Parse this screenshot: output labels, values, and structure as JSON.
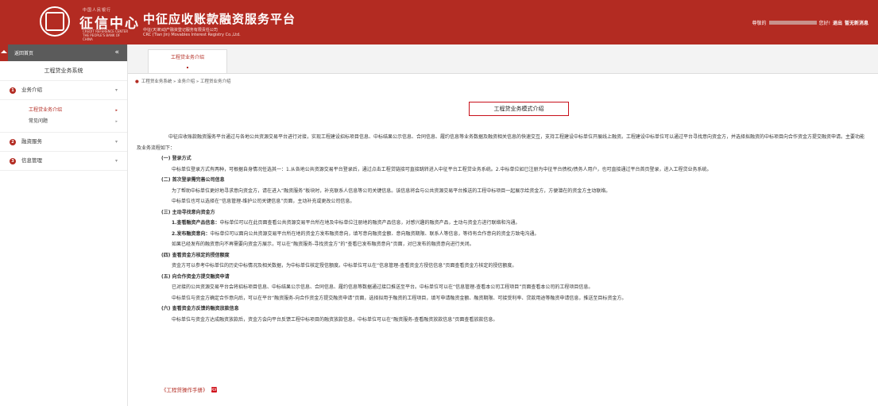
{
  "header": {
    "brand_tag": "中国人民银行",
    "brand_name": "征信中心",
    "brand_en": "Credit Reference Center The People's Bank of China",
    "platform_title": "中征应收账款融资服务平台",
    "platform_sub": "中征(天津)动产融资登记服务有限责任公司",
    "platform_sub_en": "CRC (Tian Jin) Movables Interest Registry Co.,Ltd.",
    "greeting_prefix": "尊敬的",
    "greeting_suffix": "您好!",
    "logout": "退出",
    "messages": "暂无新消息"
  },
  "sidebar": {
    "home": "返回首页",
    "collapse": "«",
    "system": "工程贷业务系统",
    "groups": [
      {
        "num": "1",
        "label": "业务介绍"
      },
      {
        "num": "2",
        "label": "融资服务"
      },
      {
        "num": "3",
        "label": "信息管理"
      }
    ],
    "sub_items": [
      {
        "label": "工程贷业务介绍"
      },
      {
        "label": "常见问题"
      }
    ]
  },
  "tab": {
    "label": "工程贷业务介绍"
  },
  "breadcrumb": "工程贷业务系统 » 业务介绍 » 工程贷业务介绍",
  "main": {
    "title": "工程贷业务模式介绍",
    "intro": "中征应收账款融资服务平台通过与各地公共资源交易平台进行对接，实现工程建设招标项目信息、中标结果公示信息、合同信息、履约信息等业务数据及融资相关信息的快速交互，支持工程建设中标单位开展线上融资。工程建设中标单位可以通过平台寻找意向资金方，并选择拟融资的中标项目向合作资金方提交融资申请。主要功能及业务流程如下：",
    "s1_title": "(一) 登录方式",
    "s1_p1": "中标单位登录方式有两种，可根据自身情况任选其一：1.从各地公共资源交易平台登录后，通过点击工程贷链接可直接跳转进入中征平台工程贷业务系统。2.中标单位如已注册为中征平台债权/债务人用户，也可直接通过平台首页登录，进入工程贷业务系统。",
    "s2_title": "(二) 首次登录需完善公司信息",
    "s2_p1": "为了帮助中标单位更好地寻求意向资金方，请在进入“融资服务”板块时，补充联系人信息等公司关键信息。该信息将会与公共资源交易平台推送的工程中标项目一起展示给资金方，方便潜在的资金方主动联络。",
    "s2_p2": "中标单位也可以选择在“信息管理-维护公司关键信息”页面，主动补充或更改公司信息。",
    "s3_title": "(三) 主动寻找意向资金方",
    "s3_p1_b": "1.查看融资产品信息：",
    "s3_p1": "中标单位可以在此页面查看公共资源交易平台所在地及中标单位注册地的融资产品信息，对感兴趣的融资产品，主动与资金方进行联络和沟通。",
    "s3_p2_b": "2.发布融资意向：",
    "s3_p2": "中标单位可以面向公共资源交易平台所在地的资金方发布融资意向，填写意向融资金额、意向融资期限、联系人等信息，等待有合作意向的资金方致电沟通。",
    "s3_p3": "如果已经发布的融资意向不再需要向资金方展示，可以在“融资服务-寻找资金方”的“查看已发布融资意向”页面，对已发布的融资意向进行关闭。",
    "s4_title": "(四) 查看资金方核定的授信额度",
    "s4_p1": "资金方可以参考中标单位的历史中标情况及相关数据，为中标单位核定授信额度。中标单位可以在“信息管理-查看资金方授信信息”页面查看资金方核定的授信额度。",
    "s5_title": "(五) 向合作资金方提交融资申请",
    "s5_p1": "已对接的公共资源交易平台会将招标项目信息、中标结果公示信息、合同信息、履约信息等数据通过接口推送至平台。中标单位可以在“信息管理-查看本公司工程项目”页面查看本公司的工程项目信息。",
    "s5_p2": "中标单位与资金方确定合作意向后，可以在平台“融资服务-向合作资金方提交融资申请”页面，选择拟用于融资的工程项目，填写申请融资金额、融资期限、可接受利率、贷款用途等融资申请信息，推送至目标资金方。",
    "s6_title": "(六) 查看资金方反馈的融资放款信息",
    "s6_p1": "中标单位与资金方达成融资放款后，资金方会向平台反馈工程中标项目的融资放款信息，中标单位可以在“融资服务-查看融资放款信息”页面查看放款信息。",
    "manual": "《工程贷操作手册》",
    "pdf_icon": "PDF"
  }
}
